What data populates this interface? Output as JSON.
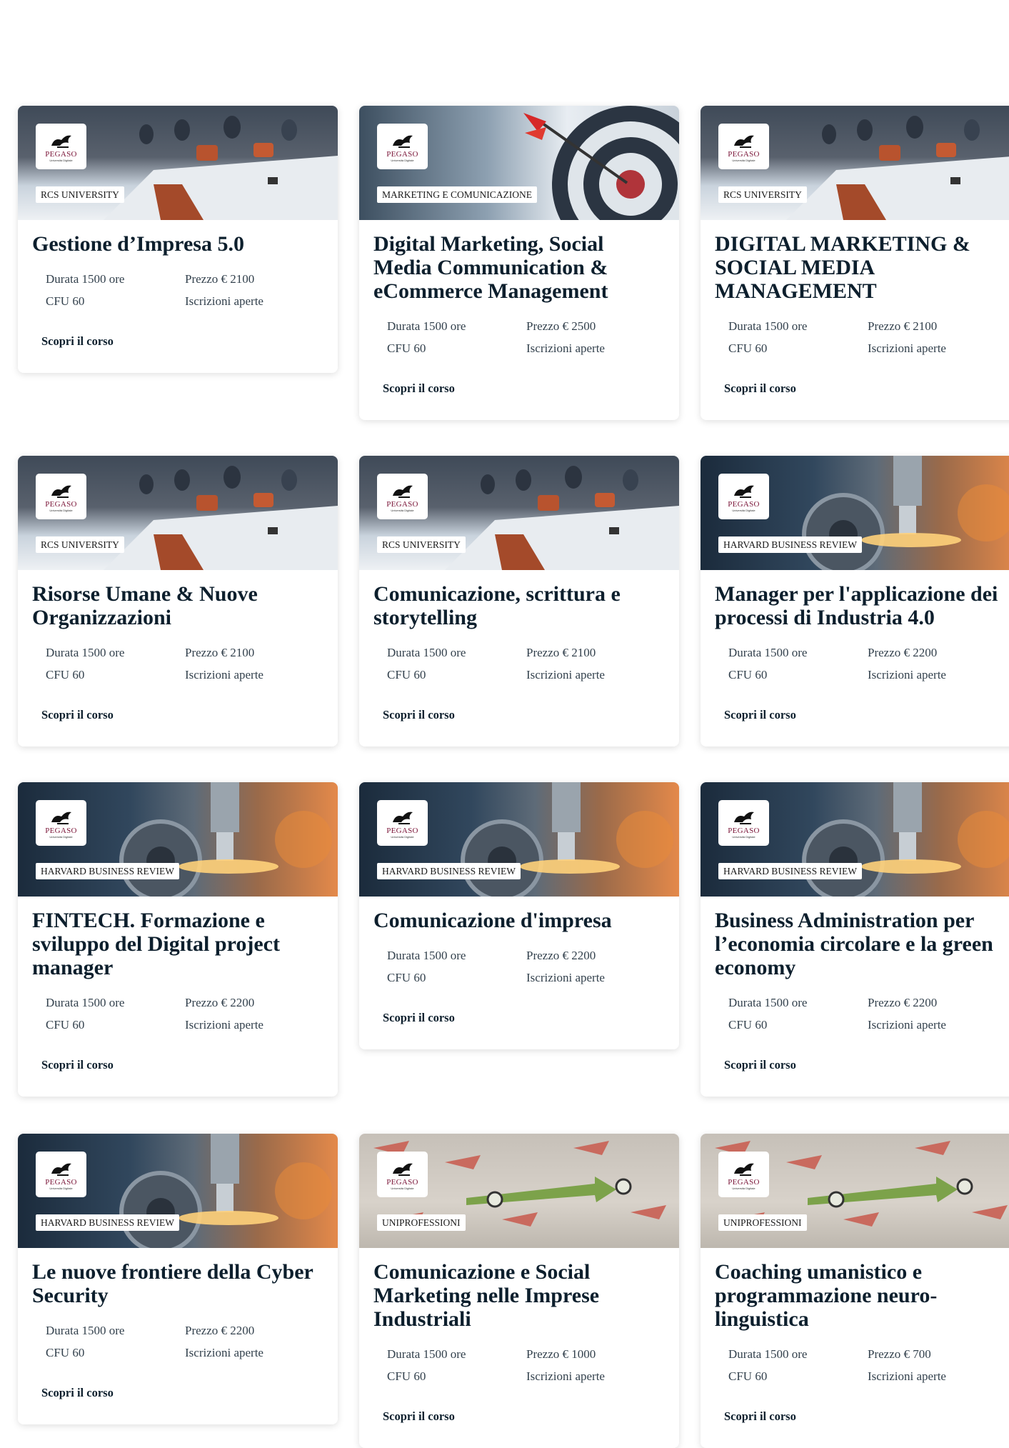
{
  "logo": {
    "word": "PEGASO",
    "sub": "Università Digitale"
  },
  "labels": {
    "duration": "Durata",
    "price": "Prezzo",
    "cfu": "CFU",
    "status": "Iscrizioni aperte",
    "cta": "Scopri il corso"
  },
  "colors": {
    "title": "#0d1f2d",
    "logo": "#7a1538",
    "card_bg": "#ffffff"
  },
  "courses": [
    {
      "title": "Gestione d’Impresa 5.0",
      "tag": "RCS UNIVERSITY",
      "image": "meeting-room",
      "durata": "Durata 1500 ore",
      "cfu": "CFU 60",
      "prezzo": "Prezzo € 2100",
      "status": "Iscrizioni aperte",
      "cta": "Scopri il corso"
    },
    {
      "title": "Digital Marketing, Social Media Communication & eCommerce Management",
      "tag": "MARKETING E COMUNICAZIONE",
      "image": "darts-target",
      "durata": "Durata 1500 ore",
      "cfu": "CFU 60",
      "prezzo": "Prezzo € 2500",
      "status": "Iscrizioni aperte",
      "cta": "Scopri il corso"
    },
    {
      "title": "DIGITAL MARKETING & SOCIAL MEDIA MANAGEMENT",
      "tag": "RCS UNIVERSITY",
      "image": "meeting-room",
      "durata": "Durata 1500 ore",
      "cfu": "CFU 60",
      "prezzo": "Prezzo € 2100",
      "status": "Iscrizioni aperte",
      "cta": "Scopri il corso"
    },
    {
      "title": "Risorse Umane & Nuove Organizzazioni",
      "tag": "RCS UNIVERSITY",
      "image": "meeting-room",
      "durata": "Durata 1500 ore",
      "cfu": "CFU 60",
      "prezzo": "Prezzo € 2100",
      "status": "Iscrizioni aperte",
      "cta": "Scopri il corso"
    },
    {
      "title": "Comunicazione, scrittura e storytelling",
      "tag": "RCS UNIVERSITY",
      "image": "meeting-room",
      "durata": "Durata 1500 ore",
      "cfu": "CFU 60",
      "prezzo": "Prezzo € 2100",
      "status": "Iscrizioni aperte",
      "cta": "Scopri il corso"
    },
    {
      "title": "Manager per l'applicazione dei processi di Industria 4.0",
      "tag": "HARVARD BUSINESS REVIEW",
      "image": "industrial-drill",
      "durata": "Durata 1500 ore",
      "cfu": "CFU 60",
      "prezzo": "Prezzo € 2200",
      "status": "Iscrizioni aperte",
      "cta": "Scopri il corso"
    },
    {
      "title": "FINTECH. Formazione e sviluppo del Digital project manager",
      "tag": "HARVARD BUSINESS REVIEW",
      "image": "industrial-drill",
      "durata": "Durata 1500 ore",
      "cfu": "CFU 60",
      "prezzo": "Prezzo € 2200",
      "status": "Iscrizioni aperte",
      "cta": "Scopri il corso"
    },
    {
      "title": "Comunicazione d'impresa",
      "tag": "HARVARD BUSINESS REVIEW",
      "image": "industrial-drill",
      "durata": "Durata 1500 ore",
      "cfu": "CFU 60",
      "prezzo": "Prezzo € 2200",
      "status": "Iscrizioni aperte",
      "cta": "Scopri il corso"
    },
    {
      "title": "Business Administration per l’economia circolare e la green economy",
      "tag": "HARVARD BUSINESS REVIEW",
      "image": "industrial-drill",
      "durata": "Durata 1500 ore",
      "cfu": "CFU 60",
      "prezzo": "Prezzo € 2200",
      "status": "Iscrizioni aperte",
      "cta": "Scopri il corso"
    },
    {
      "title": "Le nuove frontiere della Cyber Security",
      "tag": "HARVARD BUSINESS REVIEW",
      "image": "industrial-drill",
      "durata": "Durata 1500 ore",
      "cfu": "CFU 60",
      "prezzo": "Prezzo € 2200",
      "status": "Iscrizioni aperte",
      "cta": "Scopri il corso"
    },
    {
      "title": "Comunicazione e Social Marketing nelle Imprese Industriali",
      "tag": "UNIPROFESSIONI",
      "image": "arrows-floor",
      "durata": "Durata 1500 ore",
      "cfu": "CFU 60",
      "prezzo": "Prezzo € 1000",
      "status": "Iscrizioni aperte",
      "cta": "Scopri il corso"
    },
    {
      "title": "Coaching umanistico e programmazione neuro-linguistica",
      "tag": "UNIPROFESSIONI",
      "image": "arrows-floor",
      "durata": "Durata 1500 ore",
      "cfu": "CFU 60",
      "prezzo": "Prezzo € 700",
      "status": "Iscrizioni aperte",
      "cta": "Scopri il corso"
    }
  ]
}
